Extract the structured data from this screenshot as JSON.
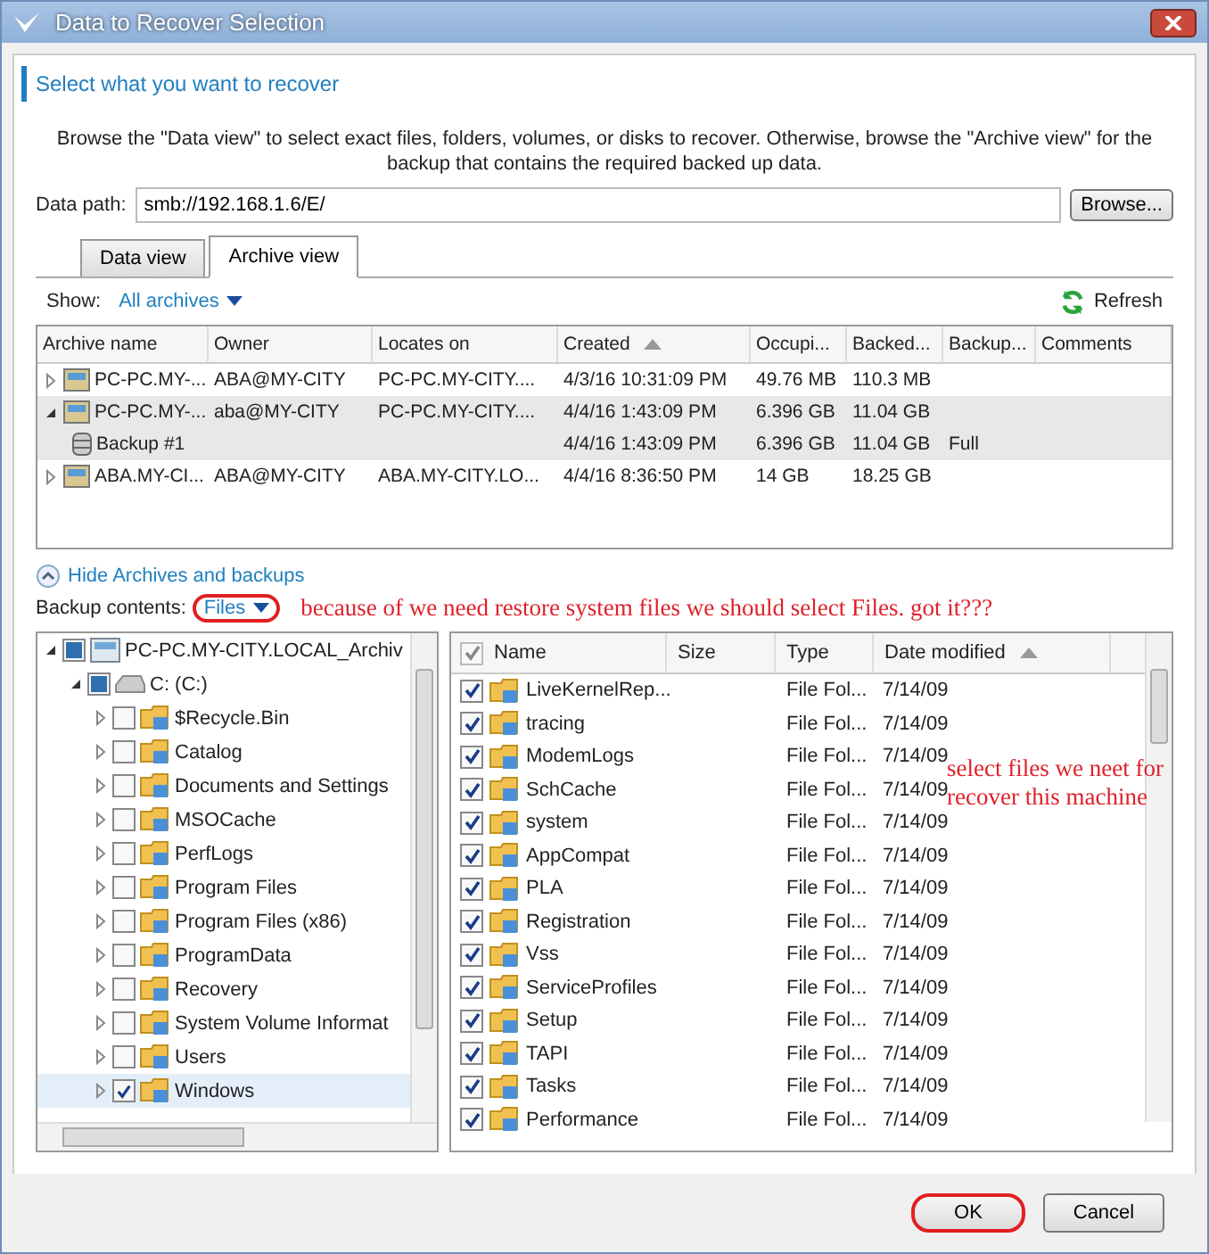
{
  "window": {
    "title": "Data to Recover Selection"
  },
  "heading": "Select what you want to recover",
  "description": "Browse the \"Data view\" to select exact files, folders, volumes, or disks to recover. Otherwise, browse the \"Archive view\" for the backup that contains the required backed up data.",
  "data_path": {
    "label": "Data path:",
    "value": "smb://192.168.1.6/E/",
    "button": "Browse..."
  },
  "tabs": [
    {
      "label": "Data view",
      "selected": false
    },
    {
      "label": "Archive view",
      "selected": true
    }
  ],
  "show": {
    "label": "Show:",
    "value": "All archives"
  },
  "refresh": "Refresh",
  "archives": {
    "columns": [
      {
        "label": "Archive name",
        "sorted": false
      },
      {
        "label": "Owner",
        "sorted": false
      },
      {
        "label": "Locates on",
        "sorted": false
      },
      {
        "label": "Created",
        "sorted": true
      },
      {
        "label": "Occupi...",
        "sorted": false
      },
      {
        "label": "Backed...",
        "sorted": false
      },
      {
        "label": "Backup...",
        "sorted": false
      },
      {
        "label": "Comments",
        "sorted": false
      }
    ],
    "rows": [
      {
        "kind": "archive",
        "expanded": false,
        "selected": false,
        "cells": [
          "PC-PC.MY-...",
          "ABA@MY-CITY",
          "PC-PC.MY-CITY....",
          "4/3/16 10:31:09 PM",
          "49.76 MB",
          "110.3 MB",
          "",
          ""
        ]
      },
      {
        "kind": "archive",
        "expanded": true,
        "selected": true,
        "cells": [
          "PC-PC.MY-...",
          "aba@MY-CITY",
          "PC-PC.MY-CITY....",
          "4/4/16 1:43:09 PM",
          "6.396 GB",
          "11.04 GB",
          "",
          ""
        ],
        "children": [
          {
            "kind": "backup",
            "selected": true,
            "cells": [
              "Backup #1",
              "",
              "",
              "4/4/16 1:43:09 PM",
              "6.396 GB",
              "11.04 GB",
              "Full",
              ""
            ]
          }
        ]
      },
      {
        "kind": "archive",
        "expanded": false,
        "selected": false,
        "cells": [
          "ABA.MY-CI...",
          "ABA@MY-CITY",
          "ABA.MY-CITY.LO...",
          "4/4/16 8:36:50 PM",
          "14 GB",
          "18.25 GB",
          "",
          ""
        ]
      }
    ]
  },
  "hide_link": "Hide Archives and backups",
  "backup_contents": {
    "label": "Backup contents:",
    "value": "Files"
  },
  "tree": [
    {
      "label": "PC-PC.MY-CITY.LOCAL_Archiv",
      "kind": "archive",
      "expanded": true,
      "checked": false,
      "mixed": true,
      "selected": false,
      "children": [
        {
          "label": "C: (C:)",
          "kind": "disk",
          "expanded": true,
          "checked": false,
          "mixed": true,
          "selected": false,
          "children": [
            {
              "label": "$Recycle.Bin",
              "kind": "folder",
              "expanded": false,
              "checked": false,
              "mixed": false,
              "selected": false
            },
            {
              "label": "Catalog",
              "kind": "folder",
              "expanded": false,
              "checked": false,
              "mixed": false,
              "selected": false
            },
            {
              "label": "Documents and Settings",
              "kind": "folder",
              "expanded": false,
              "checked": false,
              "mixed": false,
              "selected": false
            },
            {
              "label": "MSOCache",
              "kind": "folder",
              "expanded": false,
              "checked": false,
              "mixed": false,
              "selected": false
            },
            {
              "label": "PerfLogs",
              "kind": "folder",
              "expanded": false,
              "checked": false,
              "mixed": false,
              "selected": false
            },
            {
              "label": "Program Files",
              "kind": "folder",
              "expanded": false,
              "checked": false,
              "mixed": false,
              "selected": false
            },
            {
              "label": "Program Files (x86)",
              "kind": "folder",
              "expanded": false,
              "checked": false,
              "mixed": false,
              "selected": false
            },
            {
              "label": "ProgramData",
              "kind": "folder",
              "expanded": false,
              "checked": false,
              "mixed": false,
              "selected": false
            },
            {
              "label": "Recovery",
              "kind": "folder",
              "expanded": false,
              "checked": false,
              "mixed": false,
              "selected": false
            },
            {
              "label": "System Volume Informat",
              "kind": "folder",
              "expanded": false,
              "checked": false,
              "mixed": false,
              "selected": false
            },
            {
              "label": "Users",
              "kind": "folder",
              "expanded": false,
              "checked": false,
              "mixed": false,
              "selected": false
            },
            {
              "label": "Windows",
              "kind": "folder",
              "expanded": false,
              "checked": true,
              "mixed": false,
              "selected": true
            }
          ]
        }
      ]
    }
  ],
  "files": {
    "all_checked": true,
    "columns": [
      {
        "label": "Name",
        "sorted": false
      },
      {
        "label": "Size",
        "sorted": false
      },
      {
        "label": "Type",
        "sorted": false
      },
      {
        "label": "Date modified",
        "sorted": true
      }
    ],
    "rows": [
      {
        "name": "LiveKernelRep...",
        "type": "File Fol...",
        "date": "7/14/09",
        "checked": true
      },
      {
        "name": "tracing",
        "type": "File Fol...",
        "date": "7/14/09",
        "checked": true
      },
      {
        "name": "ModemLogs",
        "type": "File Fol...",
        "date": "7/14/09",
        "checked": true
      },
      {
        "name": "SchCache",
        "type": "File Fol...",
        "date": "7/14/09",
        "checked": true
      },
      {
        "name": "system",
        "type": "File Fol...",
        "date": "7/14/09",
        "checked": true
      },
      {
        "name": "AppCompat",
        "type": "File Fol...",
        "date": "7/14/09",
        "checked": true
      },
      {
        "name": "PLA",
        "type": "File Fol...",
        "date": "7/14/09",
        "checked": true
      },
      {
        "name": "Registration",
        "type": "File Fol...",
        "date": "7/14/09",
        "checked": true
      },
      {
        "name": "Vss",
        "type": "File Fol...",
        "date": "7/14/09",
        "checked": true
      },
      {
        "name": "ServiceProfiles",
        "type": "File Fol...",
        "date": "7/14/09",
        "checked": true
      },
      {
        "name": "Setup",
        "type": "File Fol...",
        "date": "7/14/09",
        "checked": true
      },
      {
        "name": "TAPI",
        "type": "File Fol...",
        "date": "7/14/09",
        "checked": true
      },
      {
        "name": "Tasks",
        "type": "File Fol...",
        "date": "7/14/09",
        "checked": true
      },
      {
        "name": "Performance",
        "type": "File Fol...",
        "date": "7/14/09",
        "checked": true
      }
    ]
  },
  "annotations": [
    "because of we need restore system files we should select Files. got it???",
    "select files we neet for recover this machine"
  ],
  "buttons": [
    "OK",
    "Cancel"
  ]
}
